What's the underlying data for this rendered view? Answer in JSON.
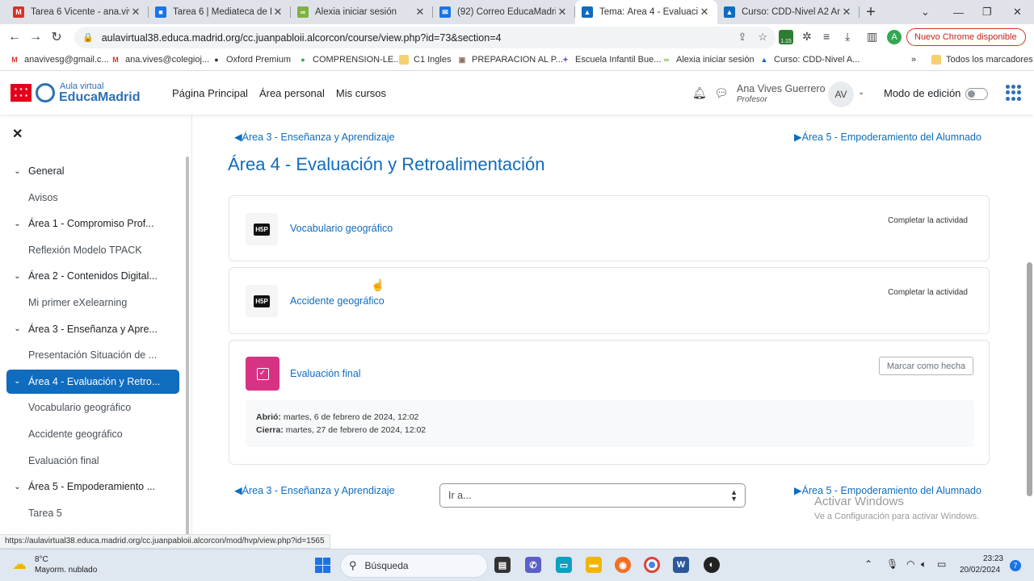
{
  "browser": {
    "tabs": [
      {
        "title": "Tarea 6 Vicente - ana.vives",
        "icon": "gmail-icon",
        "color": "#d93025",
        "glyph": "M",
        "active": false
      },
      {
        "title": "Tarea 6 | Mediateca de Edu",
        "icon": "mediateca-icon",
        "color": "#1a73e8",
        "glyph": "■",
        "active": false
      },
      {
        "title": "Alexia iniciar sesión",
        "icon": "alexia-icon",
        "color": "#7cb342",
        "glyph": "∞",
        "active": false
      },
      {
        "title": "(92) Correo EducaMadrid :",
        "icon": "mail-icon",
        "color": "#1a73e8",
        "glyph": "✉",
        "active": false
      },
      {
        "title": "Tema: Área 4 - Evaluación",
        "icon": "moodle-icon",
        "color": "#0f6cbf",
        "glyph": "▲",
        "active": true
      },
      {
        "title": "Curso: CDD-Nivel A2 Ana",
        "icon": "moodle-icon",
        "color": "#0f6cbf",
        "glyph": "▲",
        "active": false
      }
    ],
    "new_tab": "+",
    "window_controls": [
      "⌄",
      "—",
      "❐",
      "✕"
    ],
    "url": "aulavirtual38.educa.madrid.org/cc.juanpabloii.alcorcon/course/view.php?id=73&section=4",
    "update_button": "Nuevo Chrome disponible",
    "profile_initial": "A",
    "extension_badge": "1.15",
    "bookmarks": [
      {
        "label": "anavivesg@gmail.c...",
        "icon": "gmail-icon",
        "color": "#d93025",
        "glyph": "M"
      },
      {
        "label": "ana.vives@colegioj...",
        "icon": "gmail-icon",
        "color": "#d93025",
        "glyph": "M"
      },
      {
        "label": "Oxford Premium",
        "icon": "oxford-icon",
        "color": "#333333",
        "glyph": "●"
      },
      {
        "label": "COMPRENSION-LE...",
        "icon": "comprension-icon",
        "color": "#34a853",
        "glyph": "●"
      },
      {
        "label": "C1 Ingles",
        "icon": "folder-icon",
        "color": "#f4d06f",
        "glyph": ""
      },
      {
        "label": "PREPARACION AL P...",
        "icon": "preparacion-icon",
        "color": "#8d6e63",
        "glyph": "▣"
      },
      {
        "label": "Escuela Infantil Bue...",
        "icon": "escuela-icon",
        "color": "#7e57c2",
        "glyph": "✦"
      },
      {
        "label": "Alexia iniciar sesión",
        "icon": "alexia-icon",
        "color": "#7cb342",
        "glyph": "∞"
      },
      {
        "label": "Curso: CDD-Nivel A...",
        "icon": "moodle-icon",
        "color": "#0f6cbf",
        "glyph": "▲"
      }
    ],
    "bookmarks_more": "»",
    "all_bookmarks": "Todos los marcadores",
    "status_url": "https://aulavirtual38.educa.madrid.org/cc.juanpabloii.alcorcon/mod/hvp/view.php?id=1565"
  },
  "site": {
    "logo_small": "Aula virtual",
    "logo_big": "EducaMadrid",
    "nav": [
      "Página Principal",
      "Área personal",
      "Mis cursos"
    ],
    "user_name": "Ana Vives Guerrero",
    "user_role": "Profesor",
    "avatar_initials": "AV",
    "edit_mode_label": "Modo de edición",
    "edit_mode_on": false
  },
  "course_index": {
    "close": "✕",
    "items": [
      {
        "label": "General",
        "type": "section",
        "active": false
      },
      {
        "label": "Avisos",
        "type": "child",
        "active": false
      },
      {
        "label": "Área 1 - Compromiso Prof...",
        "type": "section",
        "active": false
      },
      {
        "label": "Reflexión Modelo TPACK",
        "type": "child",
        "active": false
      },
      {
        "label": "Área 2 - Contenidos Digital...",
        "type": "section",
        "active": false
      },
      {
        "label": "Mi primer eXelearning",
        "type": "child",
        "active": false
      },
      {
        "label": "Área 3 - Enseñanza y Apre...",
        "type": "section",
        "active": false
      },
      {
        "label": "Presentación Situación de ...",
        "type": "child",
        "active": false
      },
      {
        "label": "Área 4 - Evaluación y Retro...",
        "type": "section",
        "active": true
      },
      {
        "label": "Vocabulario geográfico",
        "type": "child",
        "active": false
      },
      {
        "label": "Accidente geográfico",
        "type": "child",
        "active": false
      },
      {
        "label": "Evaluación final",
        "type": "child",
        "active": false
      },
      {
        "label": "Área 5 - Empoderamiento ...",
        "type": "section",
        "active": false
      },
      {
        "label": "Tarea 5",
        "type": "child",
        "active": false
      }
    ]
  },
  "main": {
    "prev_link": "◀Área 3 - Enseñanza y Aprendizaje",
    "next_link": "▶Área 5 - Empoderamiento del Alumnado",
    "title": "Área 4 - Evaluación y Retroalimentación",
    "activities": [
      {
        "name": "Vocabulario geográfico",
        "icon_text": "H5P",
        "completion": "Completar la actividad"
      },
      {
        "name": "Accidente geográfico",
        "icon_text": "H5P",
        "completion": "Completar la actividad"
      }
    ],
    "assignment": {
      "name": "Evaluación final",
      "mark_done": "Marcar como hecha",
      "opened_label": "Abrió:",
      "opened_value": "martes, 6 de febrero de 2024, 12:02",
      "closes_label": "Cierra:",
      "closes_value": "martes, 27 de febrero de 2024, 12:02"
    },
    "jump_to": "Ir a...",
    "watermark_title": "Activar Windows",
    "watermark_sub": "Ve a Configuración para activar Windows."
  },
  "taskbar": {
    "temperature": "8°C",
    "weather": "Mayorm. nublado",
    "search_placeholder": "Búsqueda",
    "time": "23:23",
    "date": "20/02/2024",
    "notifications": "7"
  }
}
